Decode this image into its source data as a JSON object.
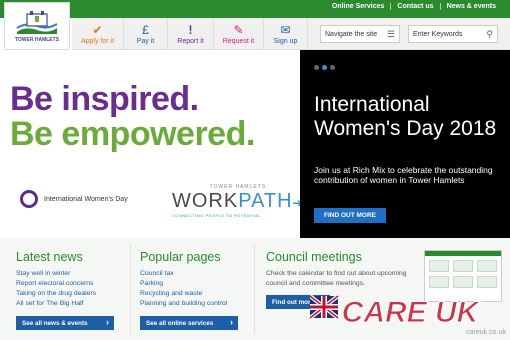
{
  "top_links": [
    "Online Services",
    "Contact us",
    "News & events"
  ],
  "logo_text": "TOWER HAMLETS",
  "nav": {
    "items": [
      {
        "label": "Apply for it",
        "icon": "check-icon",
        "glyph": "✔",
        "color": "#e07a1a"
      },
      {
        "label": "Pay it",
        "icon": "pound-icon",
        "glyph": "£",
        "color": "#1f5fa8"
      },
      {
        "label": "Report it",
        "icon": "exclamation-icon",
        "glyph": "!",
        "color": "#6b2c91"
      },
      {
        "label": "Request it",
        "icon": "pencil-icon",
        "glyph": "✎",
        "color": "#d4237a"
      },
      {
        "label": "Sign up",
        "icon": "envelope-icon",
        "glyph": "✉",
        "color": "#1f5fa8"
      }
    ],
    "navigate_label": "Navigate the site",
    "search_placeholder": "Enter Keywords"
  },
  "hero": {
    "line1": "Be inspired.",
    "line2": "Be empowered.",
    "iwd_logo_text": "International Women's Day",
    "workpath_top": "TOWER HAMLETS",
    "workpath_word": "WORK",
    "workpath_word2": "PATH",
    "workpath_sub": "CONNECTING PEOPLE TO POTENTIAL",
    "slide_title": "International Women's Day 2018",
    "slide_body": "Join us at Rich Mix to celebrate the outstanding contribution of women in Tower Hamlets",
    "find_out_more": "FIND OUT MORE"
  },
  "latest_news": {
    "title": "Latest news",
    "items": [
      "Stay well in winter",
      "Report electoral concerns",
      "Taking on the drug dealers",
      "All set for The Big Half"
    ],
    "button": "See all news & events"
  },
  "popular_pages": {
    "title": "Popular pages",
    "items": [
      "Council tax",
      "Parking",
      "Recycling and waste",
      "Planning and building control"
    ],
    "button": "See all online services"
  },
  "council_meetings": {
    "title": "Council meetings",
    "body": "Check the calendar to find out about upcoming council and committee meetings.",
    "button": "Find out more"
  },
  "watermark": {
    "text": "CARE UK",
    "sub": "careuk.co.uk"
  },
  "colors": {
    "green": "#2a8a2d",
    "purple": "#6b2c91",
    "light_green": "#6aab3a",
    "blue": "#1f5fa8"
  }
}
